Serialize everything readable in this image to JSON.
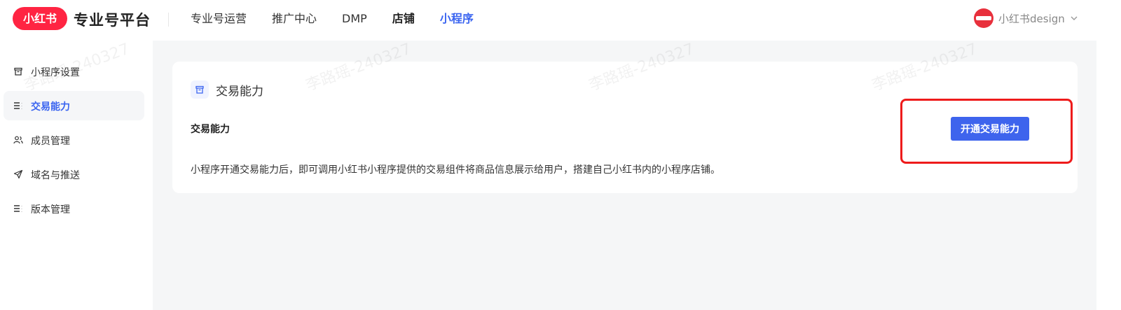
{
  "header": {
    "logo_text": "小红书",
    "app_title": "专业号平台",
    "nav": [
      {
        "label": "专业号运营"
      },
      {
        "label": "推广中心"
      },
      {
        "label": "DMP"
      },
      {
        "label": "店铺"
      },
      {
        "label": "小程序"
      }
    ],
    "active_nav": "小程序",
    "user_name": "小红书design"
  },
  "sidebar": {
    "items": [
      {
        "label": "小程序设置",
        "icon": "store-icon"
      },
      {
        "label": "交易能力",
        "icon": "list-icon"
      },
      {
        "label": "成员管理",
        "icon": "users-icon"
      },
      {
        "label": "域名与推送",
        "icon": "send-icon"
      },
      {
        "label": "版本管理",
        "icon": "list-icon"
      }
    ],
    "active_item": "交易能力"
  },
  "card": {
    "title": "交易能力",
    "section_title": "交易能力",
    "description": "小程序开通交易能力后，即可调用小红书小程序提供的交易组件将商品信息展示给用户，搭建自己小红书内的小程序店铺。",
    "button_label": "开通交易能力"
  },
  "watermark_text": "李路瑶-240327",
  "colors": {
    "brand": "#ff2442",
    "accent": "#3a64f0",
    "button": "#3e64ed",
    "highlight": "#ee1b1b"
  }
}
